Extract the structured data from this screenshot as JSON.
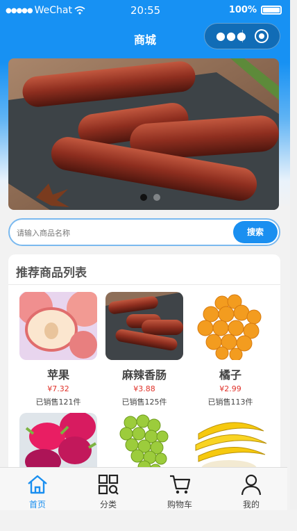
{
  "status_bar": {
    "carrier": "WeChat",
    "time": "20:55",
    "battery": "100%"
  },
  "nav": {
    "title": "商城"
  },
  "banner": {
    "slides": 2,
    "active": 1
  },
  "search": {
    "placeholder": "请输入商品名称",
    "button": "搜索"
  },
  "products": {
    "title": "推荐商品列表",
    "items": [
      {
        "name": "苹果",
        "price": "¥7.32",
        "sold": "已销售121件"
      },
      {
        "name": "麻辣香肠",
        "price": "¥3.88",
        "sold": "已销售125件"
      },
      {
        "name": "橘子",
        "price": "¥2.99",
        "sold": "已销售113件"
      },
      {
        "name": "",
        "price": "",
        "sold": ""
      },
      {
        "name": "",
        "price": "",
        "sold": ""
      },
      {
        "name": "",
        "price": "",
        "sold": ""
      }
    ]
  },
  "tabbar": {
    "items": [
      {
        "label": "首页",
        "icon": "home-icon",
        "active": true
      },
      {
        "label": "分类",
        "icon": "category-icon",
        "active": false
      },
      {
        "label": "购物车",
        "icon": "cart-icon",
        "active": false
      },
      {
        "label": "我的",
        "icon": "user-icon",
        "active": false
      }
    ]
  },
  "colors": {
    "primary": "#1a8ff0",
    "price": "#e0322a"
  }
}
